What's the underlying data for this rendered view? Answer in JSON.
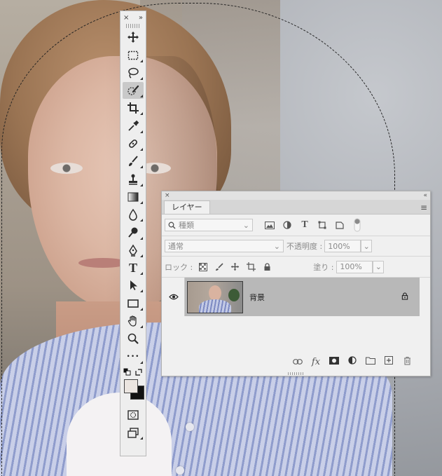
{
  "toolbar": {
    "close_glyph": "×",
    "collapse_glyph": "»",
    "tools": [
      {
        "name": "move-tool-icon"
      },
      {
        "name": "rectangular-marquee-tool-icon"
      },
      {
        "name": "lasso-tool-icon"
      },
      {
        "name": "quick-selection-tool-icon",
        "active": true
      },
      {
        "name": "crop-tool-icon"
      },
      {
        "name": "eyedropper-tool-icon"
      },
      {
        "name": "healing-brush-tool-icon"
      },
      {
        "name": "brush-tool-icon"
      },
      {
        "name": "clone-stamp-tool-icon"
      },
      {
        "name": "gradient-tool-icon"
      },
      {
        "name": "blur-tool-icon"
      },
      {
        "name": "dodge-tool-icon"
      },
      {
        "name": "pen-tool-icon"
      },
      {
        "name": "type-tool-icon"
      },
      {
        "name": "path-selection-tool-icon"
      },
      {
        "name": "rectangle-tool-icon"
      },
      {
        "name": "hand-tool-icon"
      },
      {
        "name": "zoom-tool-icon"
      },
      {
        "name": "more-tools-icon"
      }
    ],
    "type_glyph": "T",
    "more_glyph": "•••",
    "foreground_color": "#ebe5e0",
    "background_color": "#111111"
  },
  "layers_panel": {
    "close_glyph": "×",
    "collapse_glyph": "«",
    "tab_label": "レイヤー",
    "filter": {
      "kind_label": "種類"
    },
    "blend_mode": "通常",
    "opacity_label": "不透明度 :",
    "opacity_value": "100%",
    "lock_label": "ロック :",
    "fill_label": "塗り :",
    "fill_value": "100%",
    "type_filter_glyph": "T",
    "layers": [
      {
        "name": "背景",
        "visible": true,
        "locked": true
      }
    ],
    "footer": {
      "fx_label": "fx"
    }
  }
}
